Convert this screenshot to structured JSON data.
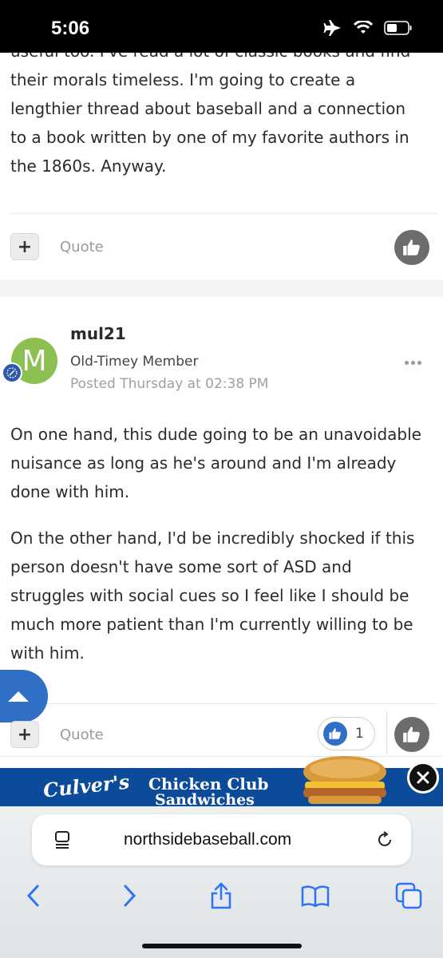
{
  "status_bar": {
    "time": "5:06"
  },
  "previous_post": {
    "lines": [
      "useful too. I've read a lot of classic books and find",
      "their morals timeless. I'm going to create a",
      "lengthier thread about baseball and a connection",
      "to a book written by one of my favorite authors in",
      "the 1860s. Anyway."
    ],
    "quote_label": "Quote"
  },
  "post": {
    "avatar_letter": "M",
    "author": "mul21",
    "member_title": "Old-Timey Member",
    "posted": "Posted Thursday at 02:38 PM",
    "paragraphs": [
      [
        "On one hand, this dude going to be an unavoidable",
        "nuisance as long as he's around and I'm already",
        "done with him."
      ],
      [
        "On the other hand, I'd be incredibly shocked if this",
        "person doesn't have some sort of ASD and",
        "struggles with social cues so I feel like I should be",
        "much more patient than I'm currently willing to be",
        "with him."
      ]
    ],
    "quote_label": "Quote",
    "reaction_count": "1"
  },
  "ad": {
    "brand": "Culver's",
    "line1": "Chicken Club",
    "line2": "Sandwiches"
  },
  "browser": {
    "url": "northsidebaseball.com"
  },
  "colors": {
    "accent": "#2f6fc5",
    "avatar": "#8cc152",
    "ad_background": "#0b4b9a"
  }
}
